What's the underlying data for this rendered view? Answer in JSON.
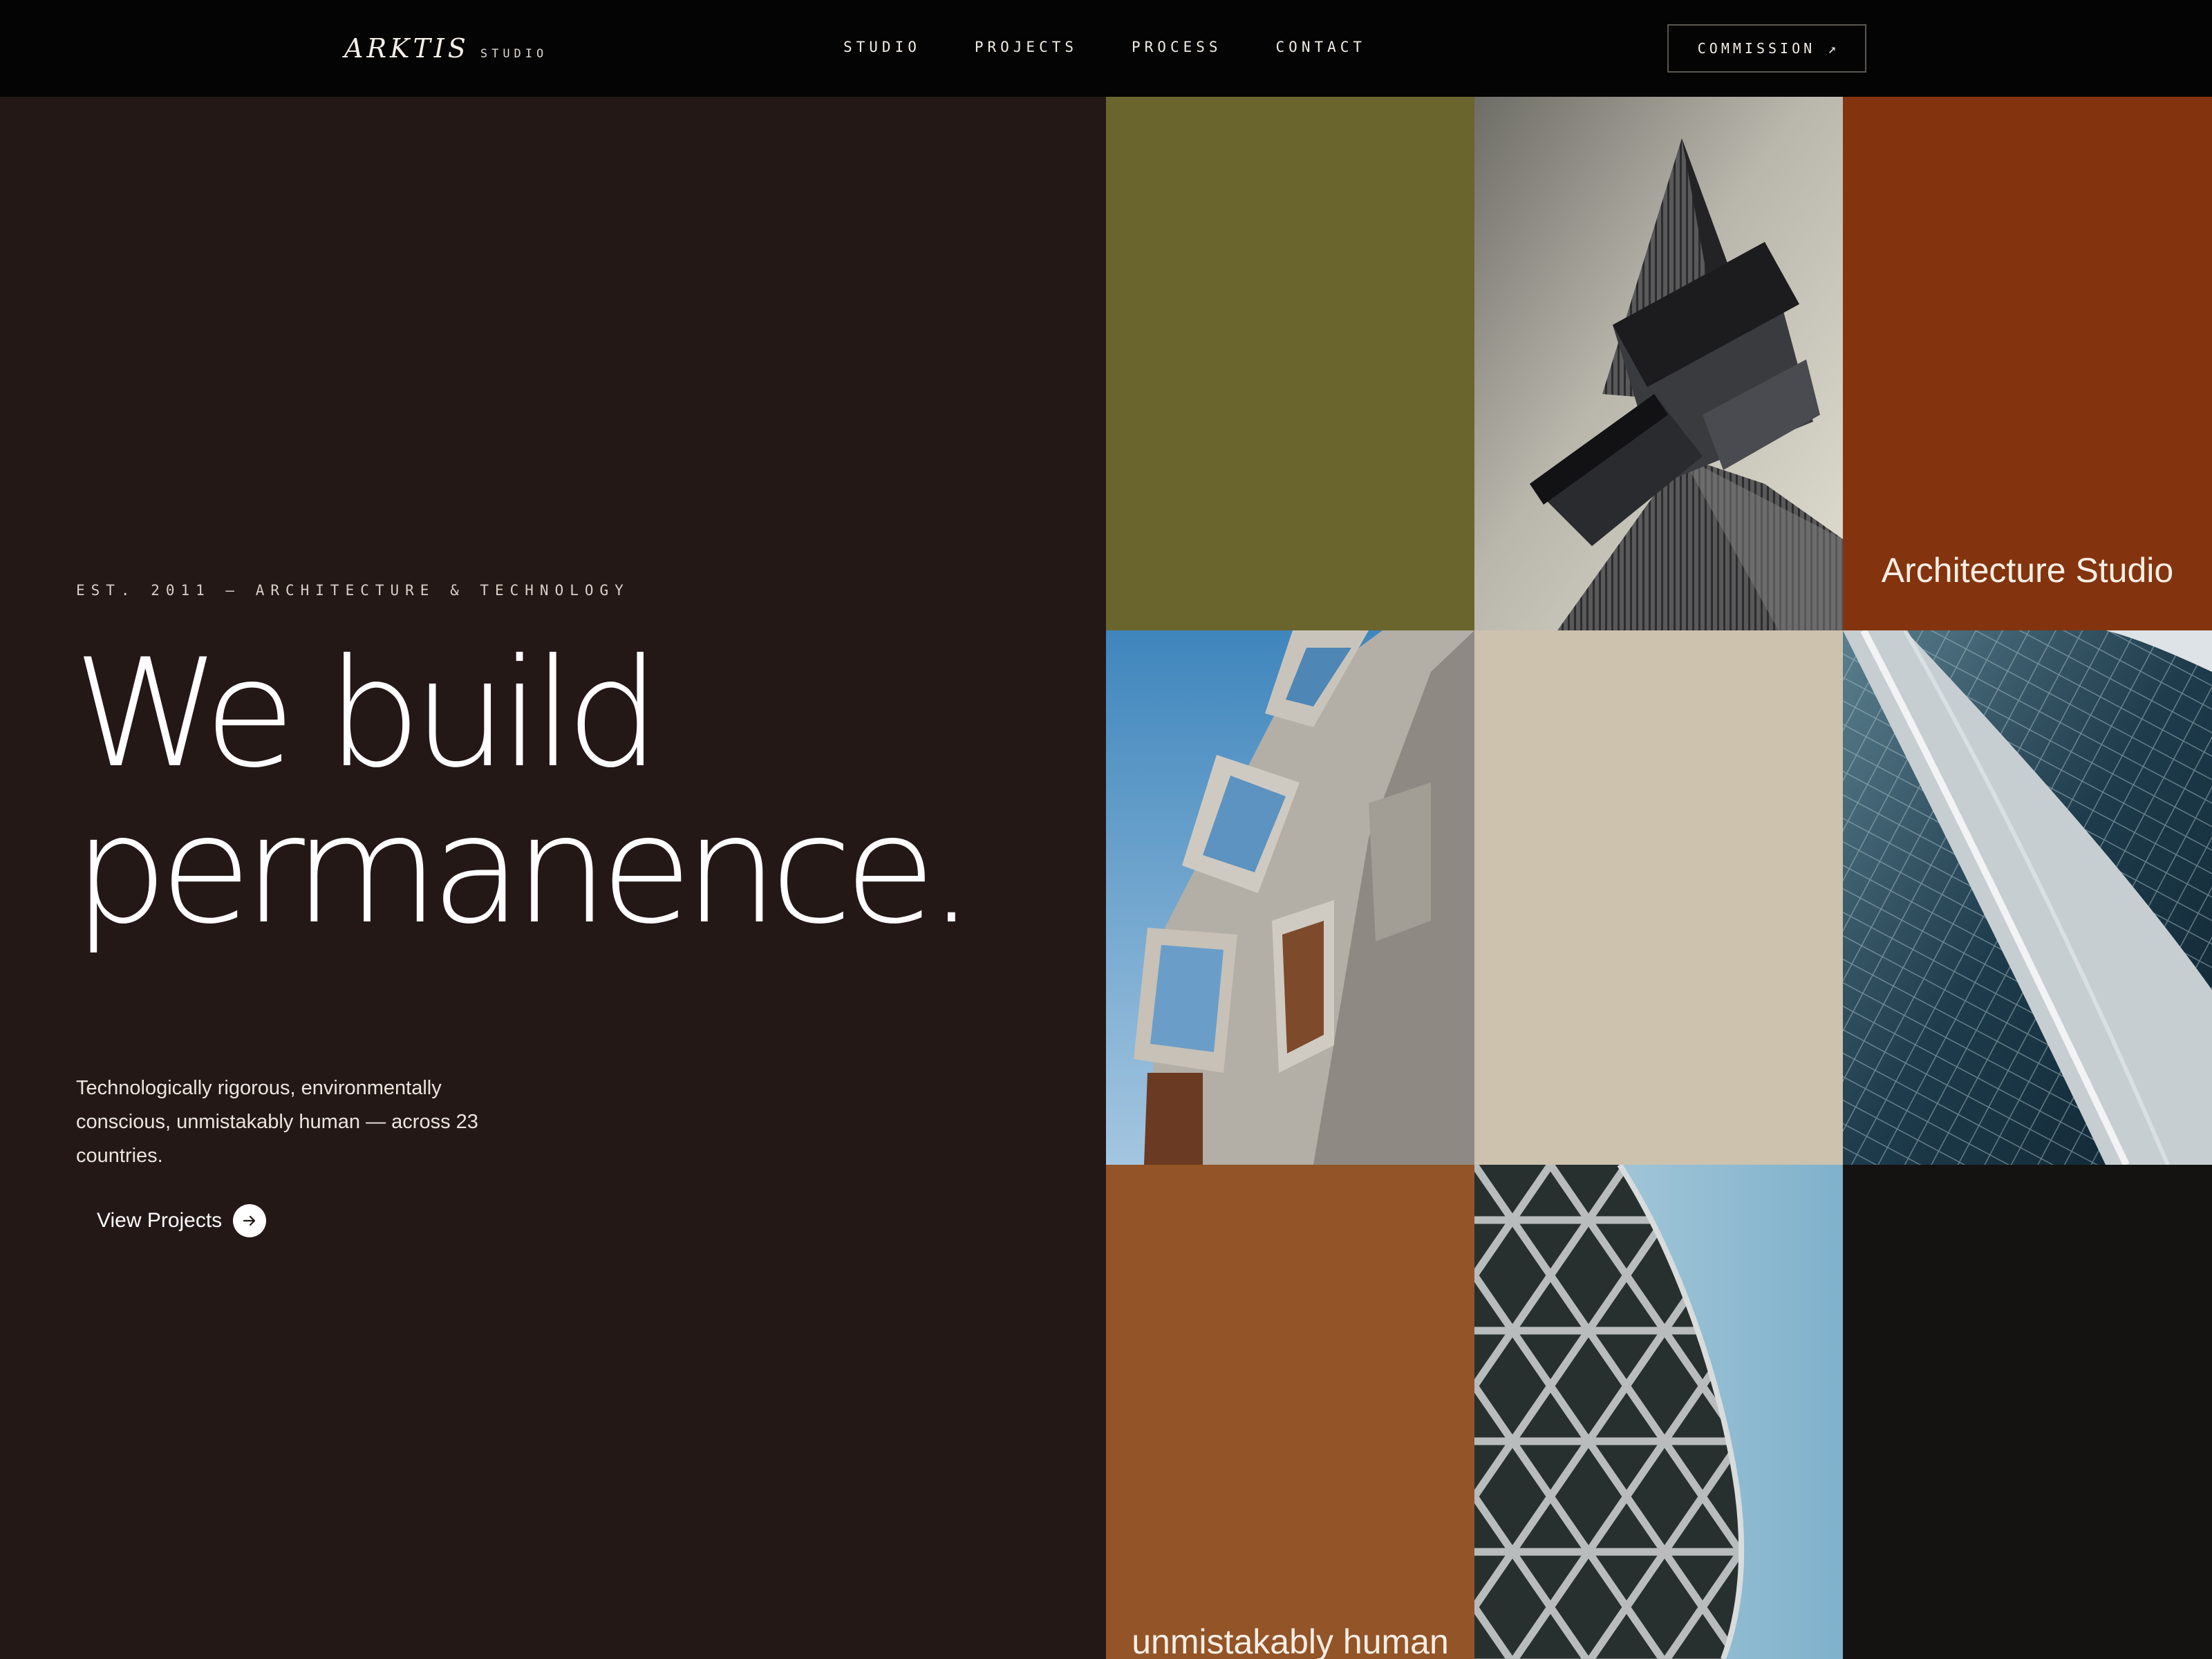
{
  "brand": {
    "name": "ARKTIS",
    "suffix": "STUDIO"
  },
  "nav": {
    "items": [
      {
        "label": "STUDIO"
      },
      {
        "label": "PROJECTS"
      },
      {
        "label": "PROCESS"
      },
      {
        "label": "CONTACT"
      }
    ],
    "cta_label": "COMMISSION",
    "cta_icon": "arrow-up-right-icon"
  },
  "hero": {
    "eyebrow": "EST. 2011 — ARCHITECTURE & TECHNOLOGY",
    "headline_line1": "We build",
    "headline_line2": "permanence.",
    "body": "Technologically rigorous, environmentally conscious, unmistakably human — across 23 countries.",
    "cta_label": "View Projects",
    "cta_icon": "arrow-right-icon"
  },
  "gallery": {
    "tiles": [
      {
        "type": "color",
        "color": "#69652d"
      },
      {
        "type": "photo",
        "subject": "angular tower against pale sky"
      },
      {
        "type": "color",
        "color": "#83340e",
        "caption": "Architecture Studio"
      },
      {
        "type": "photo",
        "subject": "concrete window boxes against blue sky"
      },
      {
        "type": "color",
        "color": "#cdc2ae"
      },
      {
        "type": "photo",
        "subject": "curved glass facade"
      },
      {
        "type": "color",
        "color": "#935427",
        "caption": "unmistakably human"
      },
      {
        "type": "photo",
        "subject": "diagrid lattice tower"
      },
      {
        "type": "color",
        "color": "#151212"
      }
    ]
  },
  "colors": {
    "nav_bg": "#050404",
    "hero_bg": "#241817",
    "text": "#ffffff"
  }
}
